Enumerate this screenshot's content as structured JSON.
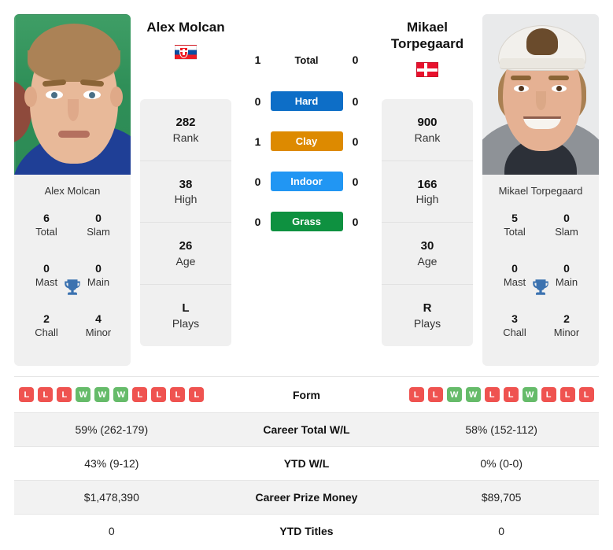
{
  "players": {
    "left": {
      "name": "Alex Molcan",
      "name_lines": [
        "Alex Molcan"
      ],
      "country_flag": "flag-slovakia",
      "photo_alt": "alex-molcan-photo",
      "card_name": "Alex Molcan",
      "titles": {
        "total": "6",
        "total_label": "Total",
        "slam": "0",
        "slam_label": "Slam",
        "mast": "0",
        "mast_label": "Mast",
        "main": "0",
        "main_label": "Main",
        "chall": "2",
        "chall_label": "Chall",
        "minor": "4",
        "minor_label": "Minor"
      },
      "stats": [
        {
          "value": "282",
          "label": "Rank"
        },
        {
          "value": "38",
          "label": "High"
        },
        {
          "value": "26",
          "label": "Age"
        },
        {
          "value": "L",
          "label": "Plays"
        }
      ],
      "form": [
        "L",
        "L",
        "L",
        "W",
        "W",
        "W",
        "L",
        "L",
        "L",
        "L"
      ],
      "career_total_wl": "59% (262-179)",
      "ytd_wl": "43% (9-12)",
      "career_prize_money": "$1,478,390",
      "ytd_titles": "0"
    },
    "right": {
      "name": "Mikael Torpegaard",
      "name_lines": [
        "Mikael",
        "Torpegaard"
      ],
      "country_flag": "flag-denmark",
      "photo_alt": "mikael-torpegaard-photo",
      "card_name": "Mikael Torpegaard",
      "titles": {
        "total": "5",
        "total_label": "Total",
        "slam": "0",
        "slam_label": "Slam",
        "mast": "0",
        "mast_label": "Mast",
        "main": "0",
        "main_label": "Main",
        "chall": "3",
        "chall_label": "Chall",
        "minor": "2",
        "minor_label": "Minor"
      },
      "stats": [
        {
          "value": "900",
          "label": "Rank"
        },
        {
          "value": "166",
          "label": "High"
        },
        {
          "value": "30",
          "label": "Age"
        },
        {
          "value": "R",
          "label": "Plays"
        }
      ],
      "form": [
        "L",
        "L",
        "W",
        "W",
        "L",
        "L",
        "W",
        "L",
        "L",
        "L"
      ],
      "career_total_wl": "58% (152-112)",
      "ytd_wl": "0% (0-0)",
      "career_prize_money": "$89,705",
      "ytd_titles": "0"
    }
  },
  "h2h": [
    {
      "key": "total",
      "label": "Total",
      "left": "1",
      "right": "0",
      "badge": false,
      "color": ""
    },
    {
      "key": "hard",
      "label": "Hard",
      "left": "0",
      "right": "0",
      "badge": true,
      "color": "#0d6ec7"
    },
    {
      "key": "clay",
      "label": "Clay",
      "left": "1",
      "right": "0",
      "badge": true,
      "color": "#dd8a00"
    },
    {
      "key": "indoor",
      "label": "Indoor",
      "left": "0",
      "right": "0",
      "badge": true,
      "color": "#2196f3"
    },
    {
      "key": "grass",
      "label": "Grass",
      "left": "0",
      "right": "0",
      "badge": true,
      "color": "#0e9140"
    }
  ],
  "table_rows": [
    {
      "key": "form",
      "label": "Form",
      "type": "form",
      "shaded": false
    },
    {
      "key": "career_wl",
      "label": "Career Total W/L",
      "type": "text",
      "shaded": true,
      "left": "59% (262-179)",
      "right": "58% (152-112)"
    },
    {
      "key": "ytd_wl",
      "label": "YTD W/L",
      "type": "text",
      "shaded": false,
      "left": "43% (9-12)",
      "right": "0% (0-0)"
    },
    {
      "key": "prize_money",
      "label": "Career Prize Money",
      "type": "text",
      "shaded": true,
      "left": "$1,478,390",
      "right": "$89,705"
    },
    {
      "key": "ytd_titles",
      "label": "YTD Titles",
      "type": "text",
      "shaded": false,
      "left": "0",
      "right": "0"
    }
  ],
  "colors": {
    "hard": "#0d6ec7",
    "clay": "#dd8a00",
    "indoor": "#2196f3",
    "grass": "#0e9140",
    "win": "#66bb6a",
    "loss": "#ef5350",
    "trophy": "#3b72b0",
    "card_bg": "#f0f0f0"
  },
  "icons": {
    "trophy": "trophy-icon",
    "flag_left": "slovakia-flag-icon",
    "flag_right": "denmark-flag-icon"
  }
}
